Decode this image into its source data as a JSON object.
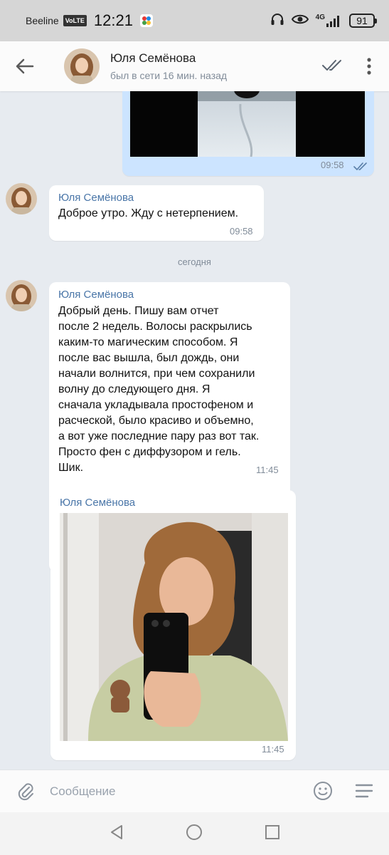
{
  "status_bar": {
    "carrier": "Beeline",
    "volte": "VoLTE",
    "time": "12:21",
    "network": "4G",
    "battery": "91"
  },
  "header": {
    "name": "Юля Семёнова",
    "status": "был в сети 16 мин. назад"
  },
  "messages": [
    {
      "type": "video",
      "direction": "outgoing",
      "time": "09:58"
    },
    {
      "type": "text",
      "sender": "Юля Семёнова",
      "text": "Доброе утро. Жду с нетерпением.",
      "time": "09:58"
    },
    {
      "type": "text",
      "sender": "Юля Семёнова",
      "lines": [
        "Добрый день. Пишу вам отчет",
        "после 2 недель. Волосы раскрылись",
        "каким-то магическим способом. Я",
        "после вас вышла, был дождь, они",
        "начали волнится, при чем сохранили",
        "волну до следующего дня. Я",
        "сначала укладывала простофеном и",
        "расческой, было красиво и объемно,",
        "а вот уже последние пару раз вот так.",
        "Просто фен с диффузором и гель.",
        "Шик."
      ],
      "time": "11:45"
    },
    {
      "type": "photo",
      "sender": "Юля Семёнова",
      "time": "11:45"
    }
  ],
  "date_separator": "сегодня",
  "composer": {
    "placeholder": "Сообщение"
  },
  "colors": {
    "accent": "#4a76a8",
    "outgoing_bubble": "#cce4ff",
    "background": "#e7ebf0"
  }
}
